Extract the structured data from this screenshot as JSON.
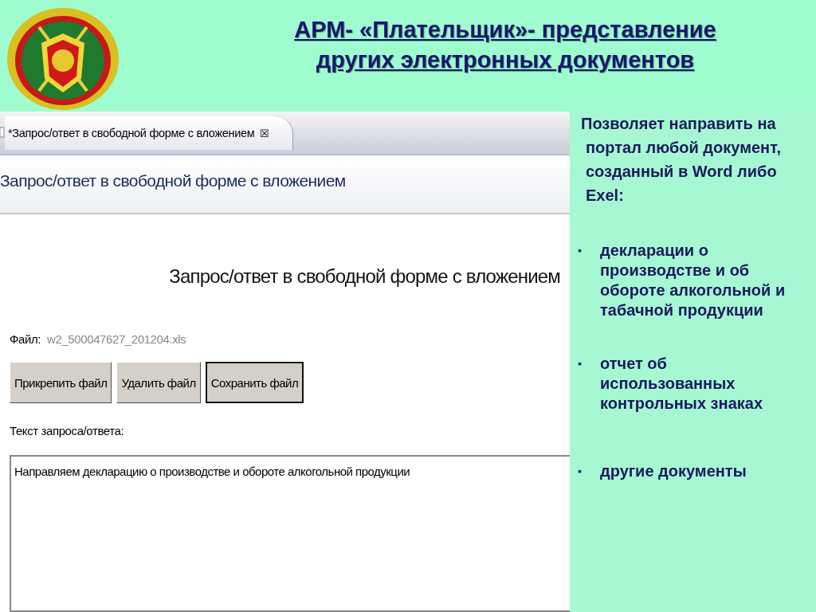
{
  "slide": {
    "title_lines": [
      "АРМ- «Плательщик»- представление",
      "других электронных документов"
    ]
  },
  "app": {
    "tabs": [
      {
        "label": "*Запрос/ответ в свободной форме с вложением",
        "selected": true,
        "close": "☒"
      }
    ],
    "header": "Запрос/ответ в свободной форме с вложением",
    "form": {
      "heading": "Запрос/ответ в свободной форме с вложением",
      "file_label": "Файл:",
      "file_name": "w2_500047627_201204.xls",
      "buttons": [
        {
          "label": "Прикрепить файл",
          "focused": false
        },
        {
          "label": "Удалить файл",
          "focused": false
        },
        {
          "label": "Сохранить файл",
          "focused": true
        }
      ],
      "text_label": "Текст запроса/ответа:",
      "text_value": "Направляем декларацию о производстве и обороте алкогольной продукции"
    }
  },
  "notes": {
    "intro": "Позволяет направить на портал любой документ, созданный в Word либо Exel:",
    "bullets": [
      {
        "marker": "▪",
        "text": "декларации о производстве и об обороте алкогольной и табачной продукции"
      },
      {
        "marker": "▪",
        "text": "отчет об использованных контрольных знаках"
      },
      {
        "marker": "▪",
        "text": "другие документы"
      }
    ]
  }
}
